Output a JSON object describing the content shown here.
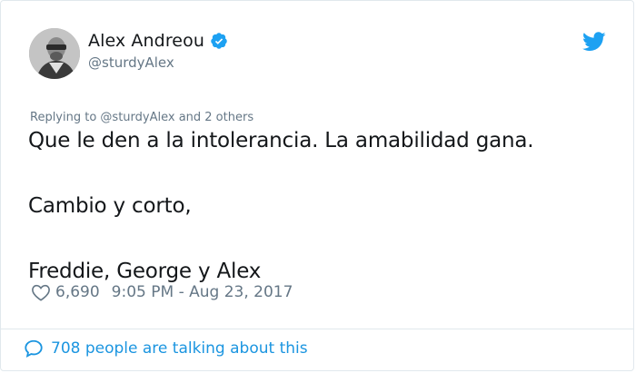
{
  "author": {
    "name": "Alex Andreou",
    "handle": "@sturdyAlex",
    "verified_icon": "verified-badge-icon",
    "avatar_icon": "avatar-photo"
  },
  "brand": {
    "logo_icon": "twitter-bird-icon",
    "accent": "#1da1f2",
    "link_color": "#1b95e0",
    "muted_color": "#657786",
    "text_color": "#14171a"
  },
  "tweet": {
    "replying_to": "Replying to @sturdyAlex and 2 others",
    "lines": [
      "Que le den a la intolerancia. La amabilidad gana.",
      "",
      "Cambio y corto,",
      "",
      "Freddie, George y Alex"
    ],
    "likes": "6,690",
    "timestamp": "9:05 PM - Aug 23, 2017"
  },
  "footer": {
    "talking": "708 people are talking about this",
    "icon": "speech-bubble-icon"
  }
}
